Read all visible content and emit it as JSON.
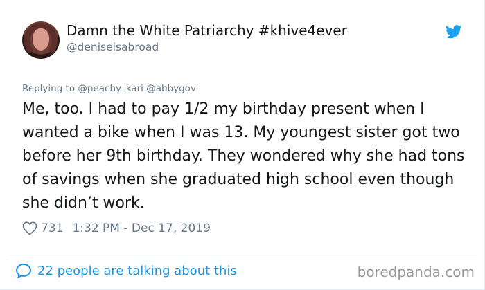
{
  "tweet": {
    "display_name": "Damn the White Patriarchy #khive4ever",
    "handle": "@deniseisabroad",
    "reply_line": "Replying to @peachy_kari @abbygov",
    "text": "Me, too. I had to pay 1/2 my birthday present when I wanted a bike when I was 13. My youngest sister got two before her 9th birthday. They wondered why she had tons of savings when she graduated high school even though she didn’t work.",
    "like_count": "731",
    "timestamp": "1:32 PM - Dec 17, 2019",
    "talking": "22 people are talking about this"
  },
  "watermark": "boredpanda.com",
  "icons": {
    "twitter": "twitter-bird-icon",
    "heart": "heart-icon",
    "comment": "speech-bubble-icon"
  },
  "colors": {
    "twitter_blue": "#1da1f2",
    "link_blue": "#1b95e0",
    "text": "#14171a",
    "muted": "#657786"
  }
}
